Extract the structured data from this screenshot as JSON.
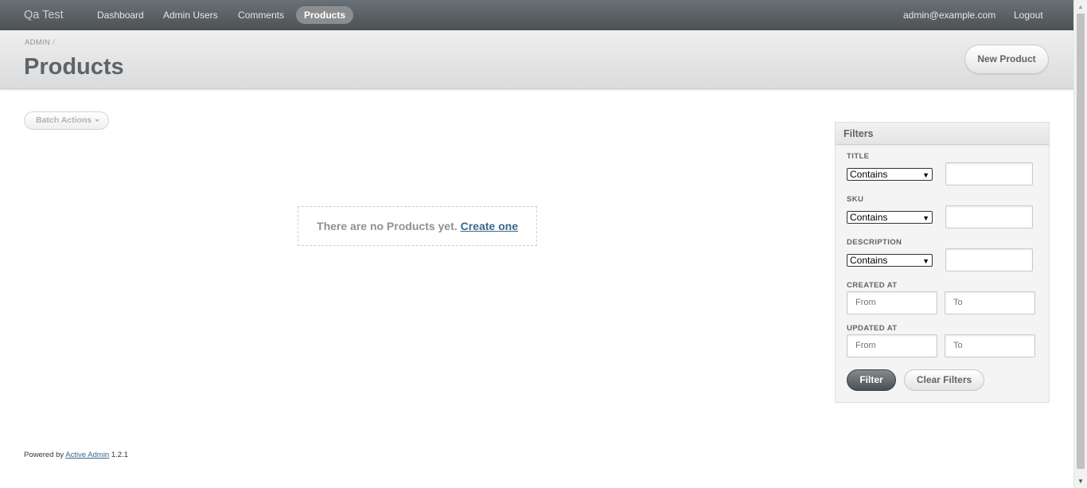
{
  "header": {
    "site_title": "Qa Test",
    "nav": [
      {
        "label": "Dashboard",
        "active": false
      },
      {
        "label": "Admin Users",
        "active": false
      },
      {
        "label": "Comments",
        "active": false
      },
      {
        "label": "Products",
        "active": true
      }
    ],
    "user_email": "admin@example.com",
    "logout_label": "Logout"
  },
  "title_bar": {
    "breadcrumb": "ADMIN",
    "breadcrumb_sep": "/",
    "title": "Products",
    "new_button": "New Product"
  },
  "main": {
    "batch_actions": "Batch Actions",
    "blank_text": "There are no Products yet.",
    "blank_link": "Create one"
  },
  "sidebar": {
    "title": "Filters",
    "filters": [
      {
        "label": "TITLE",
        "operator": "Contains",
        "value": ""
      },
      {
        "label": "SKU",
        "operator": "Contains",
        "value": ""
      },
      {
        "label": "DESCRIPTION",
        "operator": "Contains",
        "value": ""
      }
    ],
    "date_filters": [
      {
        "label": "CREATED AT",
        "from_placeholder": "From",
        "to_placeholder": "To"
      },
      {
        "label": "UPDATED AT",
        "from_placeholder": "From",
        "to_placeholder": "To"
      }
    ],
    "filter_button": "Filter",
    "clear_button": "Clear Filters"
  },
  "footer": {
    "powered_by": "Powered by",
    "link": "Active Admin",
    "version": "1.2.1"
  }
}
